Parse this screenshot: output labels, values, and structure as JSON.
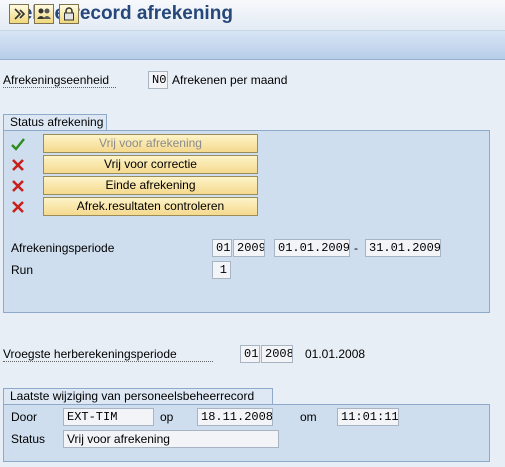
{
  "title": "Beheerrecord afrekening",
  "toolbar": {
    "icons": [
      "release-icon",
      "change-person-icon",
      "lock-icon"
    ]
  },
  "header": {
    "unit_label": "Afrekeningseenheid",
    "unit_code": "N0",
    "unit_text": "Afrekenen per maand"
  },
  "status_group": {
    "title": "Status afrekening",
    "buttons": [
      {
        "label": "Vrij voor afrekening",
        "status": "checked",
        "enabled": false
      },
      {
        "label": "Vrij voor correctie",
        "status": "cross",
        "enabled": true
      },
      {
        "label": "Einde afrekening",
        "status": "cross",
        "enabled": true
      },
      {
        "label": "Afrek.resultaten controleren",
        "status": "cross",
        "enabled": true
      }
    ],
    "period_label": "Afrekeningsperiode",
    "period_month": "01",
    "period_year": "2009",
    "period_from": "01.01.2009",
    "period_sep": "-",
    "period_to": "31.01.2009",
    "run_label": "Run",
    "run_value": "1"
  },
  "recalc": {
    "label": "Vroegste herberekeningsperiode",
    "month": "01",
    "year": "2008",
    "date": "01.01.2008"
  },
  "change_group": {
    "title": "Laatste wijziging van personeelsbeheerrecord",
    "by_label": "Door",
    "by_value": "EXT-TIM",
    "on_label": "op",
    "on_value": "18.11.2008",
    "at_label": "om",
    "at_value": "11:01:11",
    "status_label": "Status",
    "status_value": "Vrij voor afrekening"
  },
  "colors": {
    "title": "#26477a",
    "check": "#2c8a1e",
    "cross": "#c8201d"
  }
}
